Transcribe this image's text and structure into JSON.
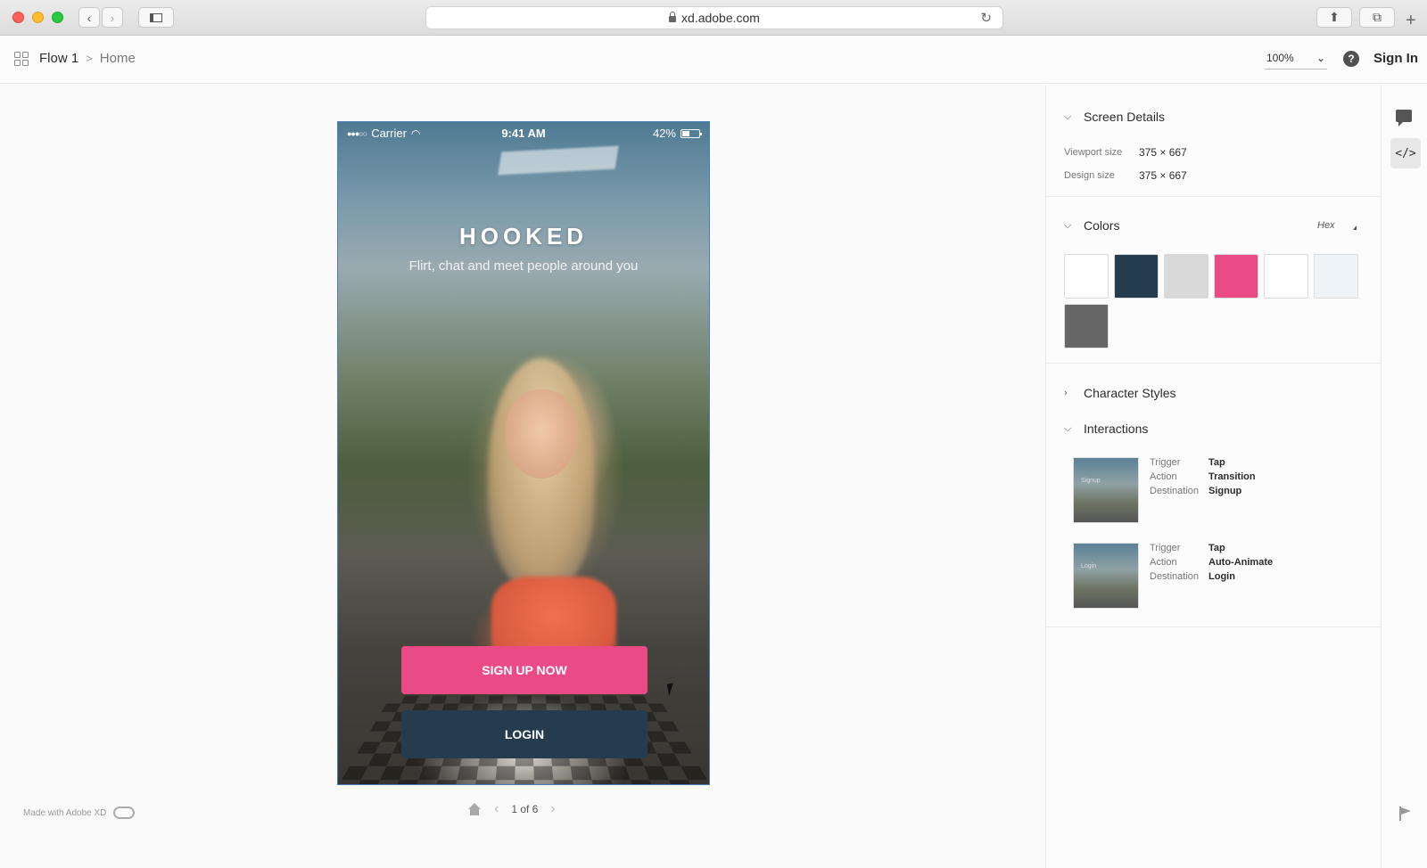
{
  "browser": {
    "url": "xd.adobe.com"
  },
  "header": {
    "flow": "Flow 1",
    "separator": ">",
    "page": "Home",
    "zoom": "100%",
    "help": "?",
    "sign_in": "Sign In"
  },
  "phone": {
    "carrier_dots": "●●●○○",
    "carrier": "Carrier",
    "time": "9:41 AM",
    "battery": "42%",
    "battery_level": 0.42,
    "title": "HOOKED",
    "subtitle": "Flirt, chat and meet people around you",
    "signup_label": "SIGN UP NOW",
    "login_label": "LOGIN"
  },
  "footer": {
    "made_with": "Made with Adobe XD",
    "pager": "1 of 6"
  },
  "inspector": {
    "screen_details": {
      "title": "Screen Details",
      "viewport_label": "Viewport size",
      "viewport_value": "375 × 667",
      "design_label": "Design size",
      "design_value": "375 × 667"
    },
    "colors": {
      "title": "Colors",
      "format": "Hex",
      "swatches": [
        "#ffffff",
        "#243c4e",
        "#d9d9d9",
        "#ea4a85",
        "#ffffff",
        "#eef3f7",
        "#666666"
      ]
    },
    "character_styles": {
      "title": "Character Styles"
    },
    "interactions": {
      "title": "Interactions",
      "items": [
        {
          "thumb_label": "Signup",
          "trigger_label": "Trigger",
          "trigger": "Tap",
          "action_label": "Action",
          "action": "Transition",
          "destination_label": "Destination",
          "destination": "Signup"
        },
        {
          "thumb_label": "Login",
          "trigger_label": "Trigger",
          "trigger": "Tap",
          "action_label": "Action",
          "action": "Auto-Animate",
          "destination_label": "Destination",
          "destination": "Login"
        }
      ]
    }
  },
  "rail": {
    "code_label": "</>"
  }
}
